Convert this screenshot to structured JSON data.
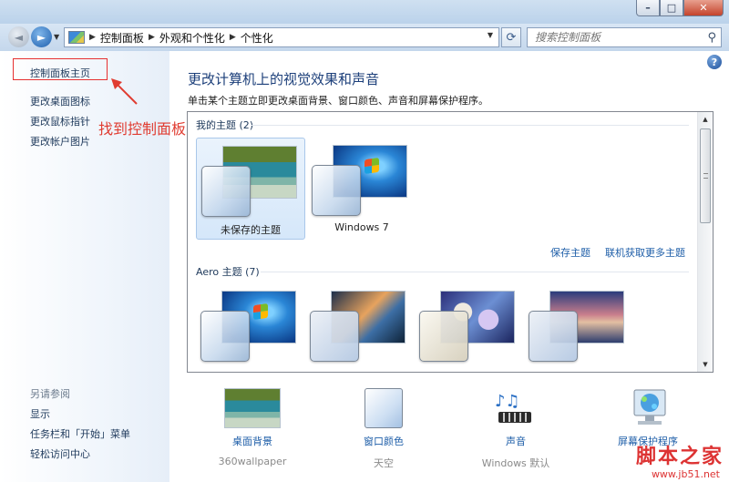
{
  "window": {
    "min_symbol": "–",
    "max_symbol": "□",
    "close_symbol": "✕"
  },
  "nav": {
    "back_icon": "◄",
    "forward_icon": "►",
    "dropdown_icon": "▼"
  },
  "address": {
    "crumbs": [
      "控制面板",
      "外观和个性化",
      "个性化"
    ],
    "separator": "▶"
  },
  "search": {
    "placeholder": "搜索控制面板"
  },
  "sidebar": {
    "home": "控制面板主页",
    "links": [
      "更改桌面图标",
      "更改鼠标指针",
      "更改帐户图片"
    ],
    "see_also_heading": "另请参阅",
    "see_also": [
      "显示",
      "任务栏和「开始」菜单",
      "轻松访问中心"
    ]
  },
  "annotation": {
    "text": "找到控制面板",
    "color": "#e03c31"
  },
  "main": {
    "title": "更改计算机上的视觉效果和声音",
    "description": "单击某个主题立即更改桌面背景、窗口颜色、声音和屏幕保护程序。",
    "my_themes_heading": "我的主题 (2)",
    "my_themes": [
      {
        "label": "未保存的主题",
        "thumb": "nature",
        "selected": true
      },
      {
        "label": "Windows 7",
        "thumb": "win7",
        "selected": false
      }
    ],
    "save_theme": "保存主题",
    "get_more": "联机获取更多主题",
    "aero_heading": "Aero 主题 (7)",
    "aero_themes": [
      {
        "thumb": "win7"
      },
      {
        "thumb": "arch"
      },
      {
        "thumb": "flowers"
      },
      {
        "thumb": "sky"
      }
    ]
  },
  "bottom": [
    {
      "label": "桌面背景",
      "sub": "360wallpaper",
      "icon": "desktop-background-icon"
    },
    {
      "label": "窗口颜色",
      "sub": "天空",
      "icon": "window-color-icon"
    },
    {
      "label": "声音",
      "sub": "Windows 默认",
      "icon": "sound-music-notes-icon"
    },
    {
      "label": "屏幕保护程序",
      "sub": "",
      "icon": "screensaver-icon"
    }
  ],
  "watermark": {
    "text": "脚本之家",
    "url": "www.jb51.net"
  },
  "colors": {
    "accent_link": "#1e5ea8",
    "title_blue": "#1c3f7a",
    "highlight_red": "#e63030"
  }
}
